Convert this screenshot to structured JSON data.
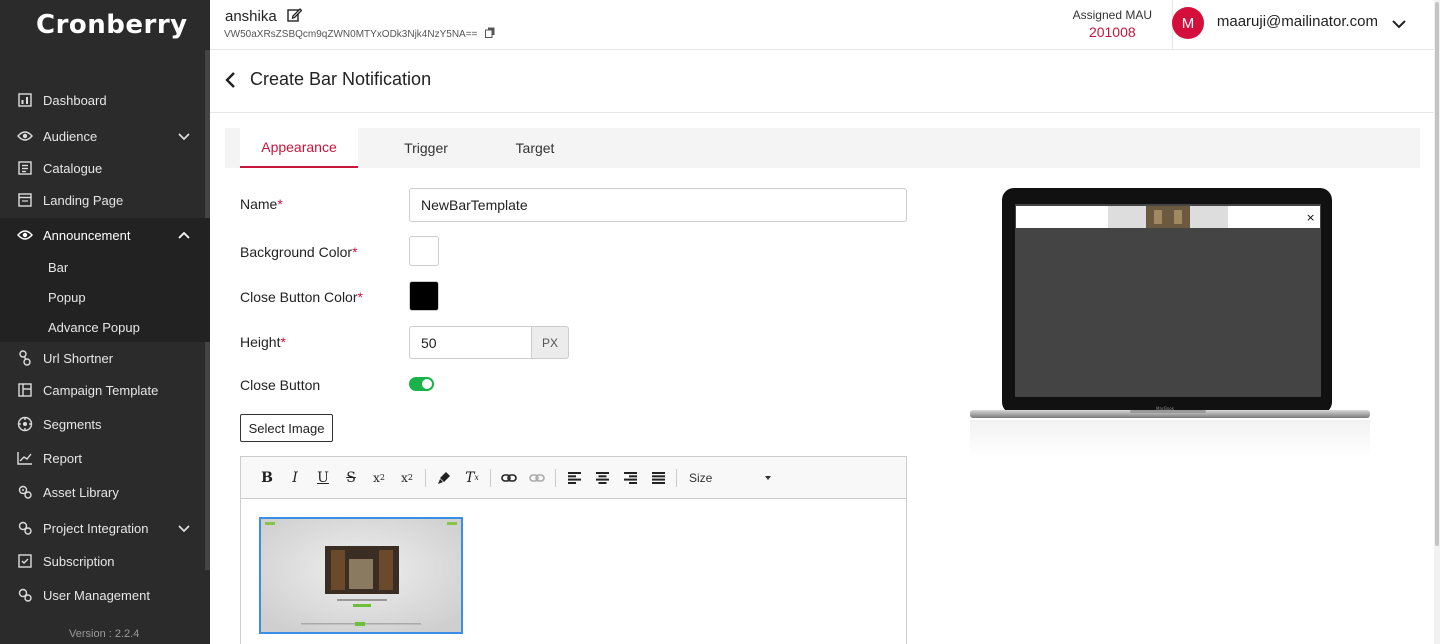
{
  "brand": {
    "name": "Cronberry"
  },
  "sidebar": {
    "items": [
      {
        "label": "Dashboard",
        "icon": "dashboard-icon"
      },
      {
        "label": "Audience",
        "icon": "eye-icon",
        "has_chevron": true
      },
      {
        "label": "Catalogue",
        "icon": "catalogue-icon"
      },
      {
        "label": "Landing Page",
        "icon": "landing-page-icon"
      },
      {
        "label": "Announcement",
        "icon": "eye-icon",
        "expanded": true
      },
      {
        "label": "Url Shortner",
        "icon": "link-icon"
      },
      {
        "label": "Campaign Template",
        "icon": "template-icon"
      },
      {
        "label": "Segments",
        "icon": "segments-icon"
      },
      {
        "label": "Report",
        "icon": "report-icon"
      },
      {
        "label": "Asset Library",
        "icon": "asset-icon"
      },
      {
        "label": "Project Integration",
        "icon": "integration-icon",
        "has_chevron": true
      },
      {
        "label": "Subscription",
        "icon": "subscription-icon"
      },
      {
        "label": "User Management",
        "icon": "user-management-icon"
      }
    ],
    "announcement_sub": [
      "Bar",
      "Popup",
      "Advance Popup"
    ],
    "version": "Version : 2.2.4"
  },
  "header": {
    "project_name": "anshika",
    "project_key": "VW50aXRsZSBQcm9qZWN0MTYxODk3Njk4NzY5NA==",
    "mau_label": "Assigned MAU",
    "mau_value": "201008",
    "avatar_letter": "M",
    "user_email": "maaruji@mailinator.com"
  },
  "page": {
    "title": "Create Bar Notification"
  },
  "tabs": [
    "Appearance",
    "Trigger",
    "Target"
  ],
  "active_tab": "Appearance",
  "form": {
    "name_label": "Name",
    "name_value": "NewBarTemplate",
    "bg_color_label": "Background Color",
    "bg_color": "#ffffff",
    "close_color_label": "Close Button Color",
    "close_color": "#000000",
    "height_label": "Height",
    "height_value": "50",
    "height_unit": "PX",
    "close_button_label": "Close Button",
    "close_button_on": true,
    "select_image_label": "Select Image",
    "required_mark": "*"
  },
  "editor": {
    "toolbar": [
      "bold",
      "italic",
      "underline",
      "strike",
      "subscript",
      "superscript",
      "clean-format",
      "remove-format",
      "link",
      "unlink",
      "align-left",
      "align-center",
      "align-right",
      "justify"
    ],
    "size_label": "Size"
  },
  "colors": {
    "accent": "#c8143b",
    "sidebar_bg": "#2b2b2b",
    "toggle_on": "#19b34a"
  }
}
